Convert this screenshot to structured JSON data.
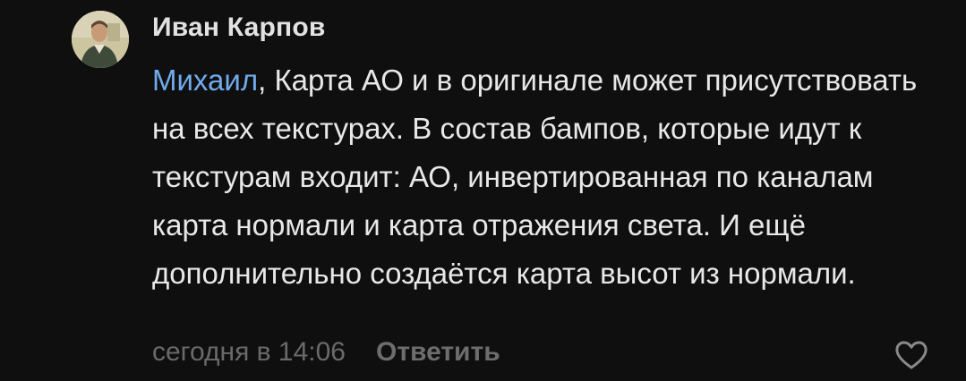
{
  "comment": {
    "author": "Иван Карпов",
    "mention": "Михаил",
    "text": ", Карта АО и в оригинале может присутствовать на всех текстурах. В состав бампов, которые идут к текстурам входит: АО, инвертированная по каналам карта нормали и карта отражения света. И ещё дополнительно создаётся карта высот из нормали.",
    "timestamp": "сегодня в 14:06",
    "reply_label": "Ответить",
    "like_icon": "heart-outline-icon"
  },
  "colors": {
    "background": "#0f0f0f",
    "author": "#e2e2e2",
    "text": "#e8e8e8",
    "mention": "#71aaeb",
    "meta": "#6a6a6a"
  }
}
